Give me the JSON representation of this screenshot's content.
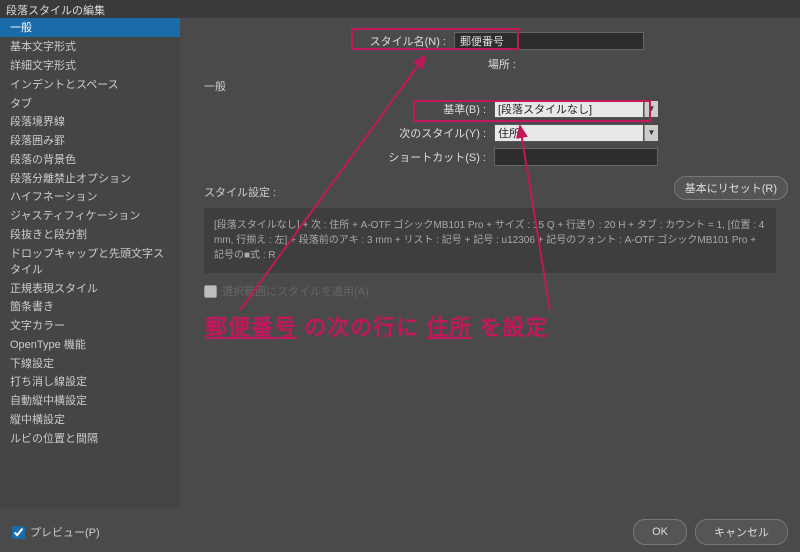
{
  "dialog": {
    "title": "段落スタイルの編集"
  },
  "sidebar": {
    "items": [
      {
        "label": "一般",
        "selected": true
      },
      {
        "label": "基本文字形式"
      },
      {
        "label": "詳細文字形式"
      },
      {
        "label": "インデントとスペース"
      },
      {
        "label": "タブ"
      },
      {
        "label": "段落境界線"
      },
      {
        "label": "段落囲み罫"
      },
      {
        "label": "段落の背景色"
      },
      {
        "label": "段落分離禁止オプション"
      },
      {
        "label": "ハイフネーション"
      },
      {
        "label": "ジャスティフィケーション"
      },
      {
        "label": "段抜きと段分割"
      },
      {
        "label": "ドロップキャップと先頭文字スタイル"
      },
      {
        "label": "正規表現スタイル"
      },
      {
        "label": "箇条書き"
      },
      {
        "label": "文字カラー"
      },
      {
        "label": "OpenType 機能"
      },
      {
        "label": "下線設定"
      },
      {
        "label": "打ち消し線設定"
      },
      {
        "label": "自動縦中横設定"
      },
      {
        "label": "縦中横設定"
      },
      {
        "label": "ルビの位置と間隔"
      }
    ]
  },
  "general": {
    "section": "一般",
    "name_label": "スタイル名(N) :",
    "name_value": "郵便番号",
    "location_label": "場所 :",
    "based_on_label": "基準(B) :",
    "based_on_value": "[段落スタイルなし]",
    "next_style_label": "次のスタイル(Y) :",
    "next_style_value": "住所",
    "shortcut_label": "ショートカット(S) :",
    "shortcut_value": "",
    "settings_label": "スタイル設定 :",
    "settings_text": "[段落スタイルなし] + 次 : 住所 + A-OTF ゴシックMB101 Pro + サイズ : 15 Q + 行送り : 20 H + タブ : カウント = 1, [位置 : 4 mm, 行揃え : 左] + 段落前のアキ : 3 mm + リスト : 記号 + 記号 : u12306 + 記号のフォント : A-OTF ゴシックMB101 Pro + 記号の■式 : R",
    "apply_label": "選択範囲にスタイルを適用(A)",
    "reset_label": "基本にリセット(R)"
  },
  "footer": {
    "preview_label": "プレビュー(P)",
    "ok_label": "OK",
    "cancel_label": "キャンセル"
  },
  "annotation": {
    "part1": "郵便番号",
    "part2": " の次の行に ",
    "part3": "住所",
    "part4": " を設定"
  }
}
